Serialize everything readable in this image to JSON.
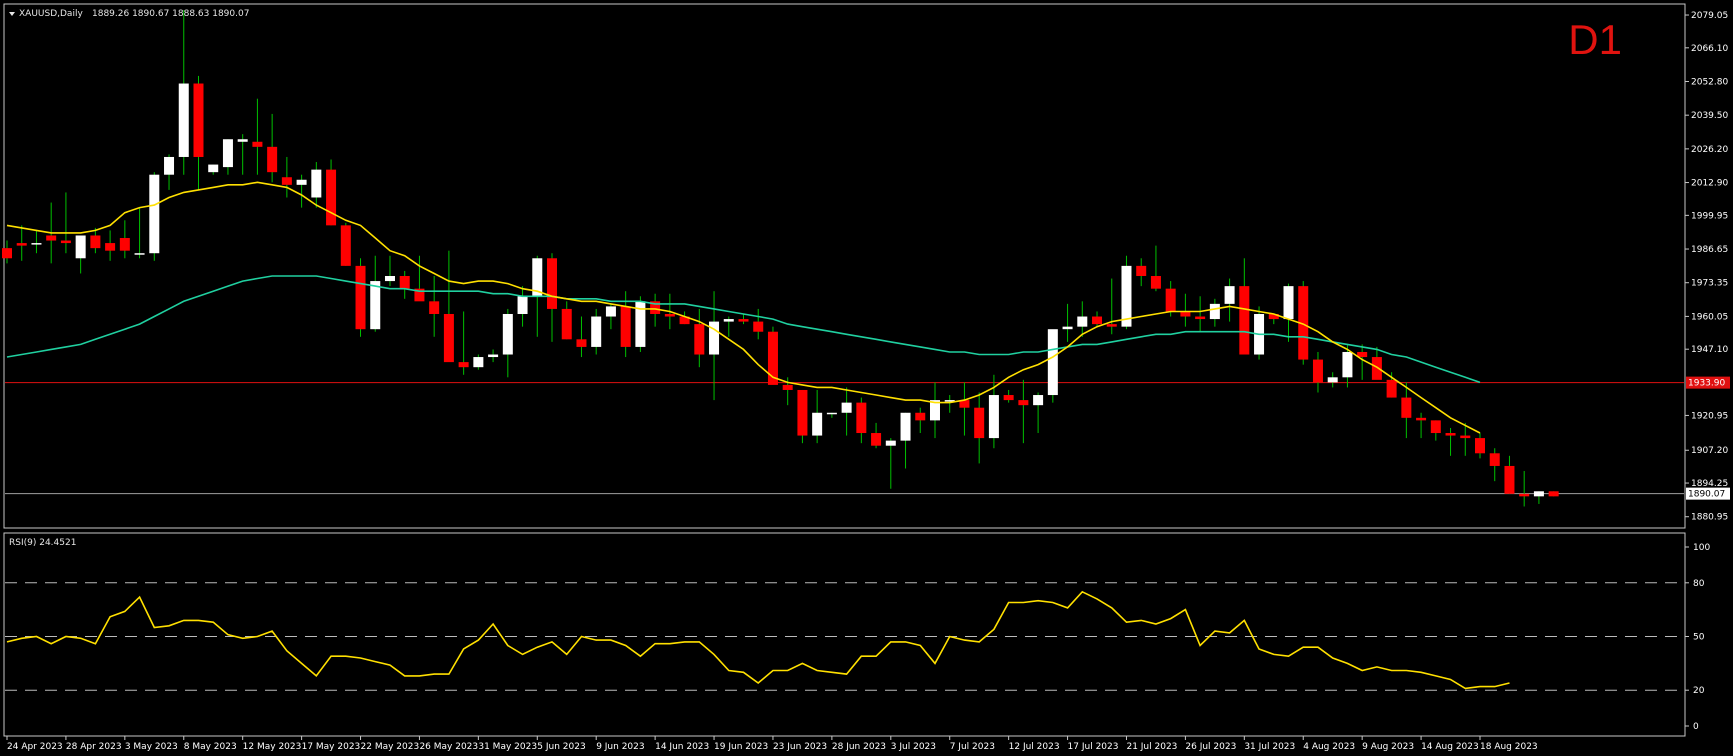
{
  "header": {
    "symbol": "XAUUSD,Daily",
    "ohlc": "1889.26 1890.67 1888.63 1890.07",
    "timeframe": "D1"
  },
  "rsi_panel": {
    "label": "RSI(9) 24.4521"
  },
  "colors": {
    "background": "#000000",
    "bull_body": "#ffffff",
    "bear_body": "#ff0000",
    "wick": "#00c000",
    "ma_fast": "#ffe000",
    "ma_slow": "#20d0a0",
    "hline": "#e01010",
    "bid_line": "#a0a0a0",
    "rsi_line": "#ffe000",
    "grid_dash": "#bbbbbb",
    "frame": "#c8c8c8"
  },
  "chart_data": [
    {
      "type": "candlestick",
      "name": "XAUUSD",
      "price_axis_ticks": [
        "2079.05",
        "2066.10",
        "2052.80",
        "2039.50",
        "2026.20",
        "2012.90",
        "1999.95",
        "1986.65",
        "1973.35",
        "1960.05",
        "1947.10",
        "1920.95",
        "1907.20",
        "1894.25",
        "1880.95"
      ],
      "ylim": [
        1876.5,
        2083.4
      ],
      "horizontal_line": {
        "value": 1933.9,
        "label": "1933.90"
      },
      "current_price": {
        "value": 1890.07,
        "label": "1890.07"
      },
      "date_ticks": [
        {
          "label": "24 Apr 2023",
          "index": 0
        },
        {
          "label": "28 Apr 2023",
          "index": 4
        },
        {
          "label": "3 May 2023",
          "index": 8
        },
        {
          "label": "8 May 2023",
          "index": 12
        },
        {
          "label": "12 May 2023",
          "index": 16
        },
        {
          "label": "17 May 2023",
          "index": 20
        },
        {
          "label": "22 May 2023",
          "index": 24
        },
        {
          "label": "26 May 2023",
          "index": 28
        },
        {
          "label": "31 May 2023",
          "index": 32
        },
        {
          "label": "5 Jun 2023",
          "index": 36
        },
        {
          "label": "9 Jun 2023",
          "index": 40
        },
        {
          "label": "14 Jun 2023",
          "index": 44
        },
        {
          "label": "19 Jun 2023",
          "index": 48
        },
        {
          "label": "23 Jun 2023",
          "index": 52
        },
        {
          "label": "28 Jun 2023",
          "index": 56
        },
        {
          "label": "3 Jul 2023",
          "index": 60
        },
        {
          "label": "7 Jul 2023",
          "index": 64
        },
        {
          "label": "12 Jul 2023",
          "index": 68
        },
        {
          "label": "17 Jul 2023",
          "index": 72
        },
        {
          "label": "21 Jul 2023",
          "index": 76
        },
        {
          "label": "26 Jul 2023",
          "index": 80
        },
        {
          "label": "31 Jul 2023",
          "index": 84
        },
        {
          "label": "4 Aug 2023",
          "index": 88
        },
        {
          "label": "9 Aug 2023",
          "index": 92
        },
        {
          "label": "14 Aug 2023",
          "index": 96
        },
        {
          "label": "18 Aug 2023",
          "index": 100
        }
      ],
      "candles": [
        [
          1987,
          1990,
          1981,
          1983
        ],
        [
          1989,
          1996,
          1982,
          1988
        ],
        [
          1989,
          1994,
          1985,
          1989
        ],
        [
          1992,
          2005,
          1981,
          1990
        ],
        [
          1990,
          2009,
          1985,
          1989
        ],
        [
          1983,
          1992,
          1977,
          1992
        ],
        [
          1992,
          1995,
          1985,
          1987
        ],
        [
          1989,
          1994,
          1982,
          1986
        ],
        [
          1991,
          1998,
          1983,
          1986
        ],
        [
          1985,
          2003,
          1983,
          1985
        ],
        [
          1985,
          2017,
          1982,
          2016
        ],
        [
          2016,
          2024,
          2010,
          2023
        ],
        [
          2023,
          2081,
          2016,
          2052
        ],
        [
          2052,
          2055,
          2010,
          2023
        ],
        [
          2017,
          2020,
          2016,
          2020
        ],
        [
          2019,
          2030,
          2016,
          2030
        ],
        [
          2029,
          2032,
          2016,
          2030
        ],
        [
          2029,
          2046,
          2016,
          2027
        ],
        [
          2027,
          2040,
          2013,
          2017
        ],
        [
          2015,
          2023,
          2007,
          2012
        ],
        [
          2012,
          2016,
          2003,
          2014
        ],
        [
          2007,
          2021,
          2003,
          2018
        ],
        [
          2018,
          2022,
          1996,
          1996
        ],
        [
          1996,
          1997,
          1980,
          1980
        ],
        [
          1980,
          1983,
          1952,
          1955
        ],
        [
          1955,
          1984,
          1954,
          1974
        ],
        [
          1974,
          1984,
          1972,
          1976
        ],
        [
          1976,
          1978,
          1967,
          1971
        ],
        [
          1971,
          1984,
          1969,
          1966
        ],
        [
          1966,
          1976,
          1952,
          1961
        ],
        [
          1961,
          1986,
          1956,
          1942
        ],
        [
          1942,
          1962,
          1937,
          1940
        ],
        [
          1940,
          1945,
          1939,
          1944
        ],
        [
          1944,
          1947,
          1942,
          1945
        ],
        [
          1945,
          1963,
          1936,
          1961
        ],
        [
          1961,
          1972,
          1956,
          1968
        ],
        [
          1968,
          1984,
          1952,
          1983
        ],
        [
          1983,
          1985,
          1950,
          1963
        ],
        [
          1963,
          1966,
          1951,
          1951
        ],
        [
          1951,
          1960,
          1944,
          1948
        ],
        [
          1948,
          1963,
          1945,
          1960
        ],
        [
          1960,
          1965,
          1955,
          1964
        ],
        [
          1964,
          1970,
          1944,
          1948
        ],
        [
          1948,
          1968,
          1946,
          1966
        ],
        [
          1966,
          1969,
          1956,
          1961
        ],
        [
          1961,
          1969,
          1955,
          1960
        ],
        [
          1960,
          1962,
          1957,
          1957
        ],
        [
          1957,
          1963,
          1940,
          1945
        ],
        [
          1945,
          1970,
          1927,
          1958
        ],
        [
          1958,
          1960,
          1952,
          1959
        ],
        [
          1959,
          1961,
          1957,
          1958
        ],
        [
          1958,
          1963,
          1951,
          1954
        ],
        [
          1954,
          1956,
          1934,
          1933
        ],
        [
          1933,
          1936,
          1925,
          1931
        ],
        [
          1931,
          1931,
          1910,
          1913
        ],
        [
          1913,
          1931,
          1910,
          1922
        ],
        [
          1922,
          1922,
          1920,
          1922
        ],
        [
          1922,
          1932,
          1913,
          1926
        ],
        [
          1926,
          1928,
          1910,
          1914
        ],
        [
          1914,
          1918,
          1908,
          1909
        ],
        [
          1909,
          1912,
          1892,
          1911
        ],
        [
          1911,
          1922,
          1900,
          1922
        ],
        [
          1922,
          1924,
          1914,
          1919
        ],
        [
          1919,
          1934,
          1912,
          1927
        ],
        [
          1927,
          1929,
          1922,
          1927
        ],
        [
          1927,
          1934,
          1913,
          1924
        ],
        [
          1924,
          1930,
          1902,
          1912
        ],
        [
          1912,
          1937,
          1908,
          1929
        ],
        [
          1929,
          1931,
          1926,
          1927
        ],
        [
          1927,
          1935,
          1910,
          1925
        ],
        [
          1925,
          1930,
          1914,
          1929
        ],
        [
          1929,
          1945,
          1926,
          1955
        ],
        [
          1955,
          1965,
          1950,
          1956
        ],
        [
          1956,
          1966,
          1952,
          1960
        ],
        [
          1960,
          1962,
          1956,
          1957
        ],
        [
          1957,
          1975,
          1953,
          1956
        ],
        [
          1956,
          1984,
          1955,
          1980
        ],
        [
          1980,
          1983,
          1972,
          1976
        ],
        [
          1976,
          1988,
          1970,
          1971
        ],
        [
          1971,
          1974,
          1960,
          1962
        ],
        [
          1962,
          1969,
          1956,
          1960
        ],
        [
          1960,
          1968,
          1954,
          1959
        ],
        [
          1959,
          1967,
          1956,
          1965
        ],
        [
          1965,
          1975,
          1958,
          1972
        ],
        [
          1972,
          1983,
          1949,
          1945
        ],
        [
          1945,
          1964,
          1943,
          1961
        ],
        [
          1961,
          1961,
          1957,
          1959
        ],
        [
          1959,
          1973,
          1950,
          1972
        ],
        [
          1972,
          1974,
          1941,
          1943
        ],
        [
          1943,
          1946,
          1930,
          1934
        ],
        [
          1934,
          1938,
          1932,
          1936
        ],
        [
          1936,
          1949,
          1932,
          1946
        ],
        [
          1946,
          1949,
          1935,
          1944
        ],
        [
          1944,
          1948,
          1936,
          1935
        ],
        [
          1935,
          1938,
          1928,
          1928
        ],
        [
          1928,
          1934,
          1912,
          1920
        ],
        [
          1920,
          1922,
          1912,
          1919
        ],
        [
          1919,
          1919,
          1911,
          1914
        ],
        [
          1914,
          1916,
          1905,
          1913
        ],
        [
          1913,
          1918,
          1905,
          1912
        ],
        [
          1912,
          1914,
          1904,
          1906
        ],
        [
          1906,
          1908,
          1895,
          1901
        ],
        [
          1901,
          1905,
          1890,
          1890
        ],
        [
          1890,
          1899,
          1885,
          1889
        ],
        [
          1889,
          1891,
          1886,
          1891
        ],
        [
          1891,
          1891,
          1889,
          1889
        ]
      ],
      "ma_fast": [
        1996,
        1995,
        1994,
        1993,
        1993,
        1993,
        1994,
        1996,
        2001,
        2003,
        2004,
        2007,
        2009,
        2010,
        2011,
        2012,
        2012,
        2013,
        2012,
        2011,
        2008,
        2004,
        2001,
        1998,
        1996,
        1991,
        1986,
        1984,
        1980,
        1977,
        1974,
        1973,
        1974,
        1974,
        1973,
        1971,
        1970,
        1968,
        1967,
        1966,
        1966,
        1965,
        1964,
        1963,
        1963,
        1962,
        1960,
        1958,
        1955,
        1951,
        1947,
        1941,
        1936,
        1934,
        1933,
        1932,
        1932,
        1931,
        1930,
        1929,
        1928,
        1927,
        1927,
        1926,
        1926,
        1927,
        1929,
        1932,
        1936,
        1939,
        1941,
        1944,
        1948,
        1953,
        1956,
        1958,
        1959,
        1960,
        1961,
        1962,
        1962,
        1962,
        1963,
        1964,
        1963,
        1962,
        1961,
        1959,
        1957,
        1954,
        1950,
        1947,
        1943,
        1940,
        1936,
        1932,
        1928,
        1924,
        1920,
        1917,
        1914
      ],
      "ma_slow": [
        1944,
        1945,
        1946,
        1947,
        1948,
        1949,
        1951,
        1953,
        1955,
        1957,
        1960,
        1963,
        1966,
        1968,
        1970,
        1972,
        1974,
        1975,
        1976,
        1976,
        1976,
        1976,
        1975,
        1974,
        1973,
        1972,
        1971,
        1971,
        1970,
        1970,
        1970,
        1970,
        1970,
        1969,
        1969,
        1968,
        1968,
        1968,
        1967,
        1967,
        1967,
        1966,
        1966,
        1966,
        1965,
        1965,
        1965,
        1964,
        1963,
        1962,
        1961,
        1960,
        1959,
        1957,
        1956,
        1955,
        1954,
        1953,
        1952,
        1951,
        1950,
        1949,
        1948,
        1947,
        1946,
        1946,
        1945,
        1945,
        1945,
        1946,
        1946,
        1947,
        1948,
        1949,
        1949,
        1950,
        1951,
        1952,
        1953,
        1953,
        1954,
        1954,
        1954,
        1954,
        1954,
        1953,
        1953,
        1952,
        1952,
        1951,
        1950,
        1949,
        1948,
        1947,
        1945,
        1944,
        1942,
        1940,
        1938,
        1936,
        1934
      ]
    },
    {
      "type": "line",
      "name": "RSI(9)",
      "ylim": [
        0,
        100
      ],
      "levels": [
        20,
        50,
        80
      ],
      "axis_ticks": [
        "100",
        "80",
        "50",
        "20",
        "0"
      ],
      "values": [
        47,
        49,
        50,
        46,
        50,
        49,
        46,
        61,
        64,
        72,
        55,
        56,
        59,
        59,
        58,
        51,
        49,
        50,
        53,
        42,
        35,
        28,
        39,
        39,
        38,
        36,
        34,
        28,
        28,
        29,
        29,
        43,
        48,
        57,
        45,
        40,
        44,
        47,
        40,
        50,
        48,
        48,
        45,
        39,
        46,
        46,
        47,
        47,
        40,
        31,
        30,
        24,
        31,
        31,
        35,
        31,
        30,
        29,
        39,
        39,
        47,
        47,
        45,
        35,
        50,
        48,
        47,
        54,
        69,
        69,
        70,
        69,
        66,
        75,
        71,
        66,
        58,
        59,
        57,
        60,
        65,
        45,
        53,
        52,
        59,
        43,
        40,
        39,
        44,
        44,
        38,
        35,
        31,
        33,
        31,
        31,
        30,
        28,
        26,
        21,
        22,
        22,
        24
      ]
    }
  ]
}
